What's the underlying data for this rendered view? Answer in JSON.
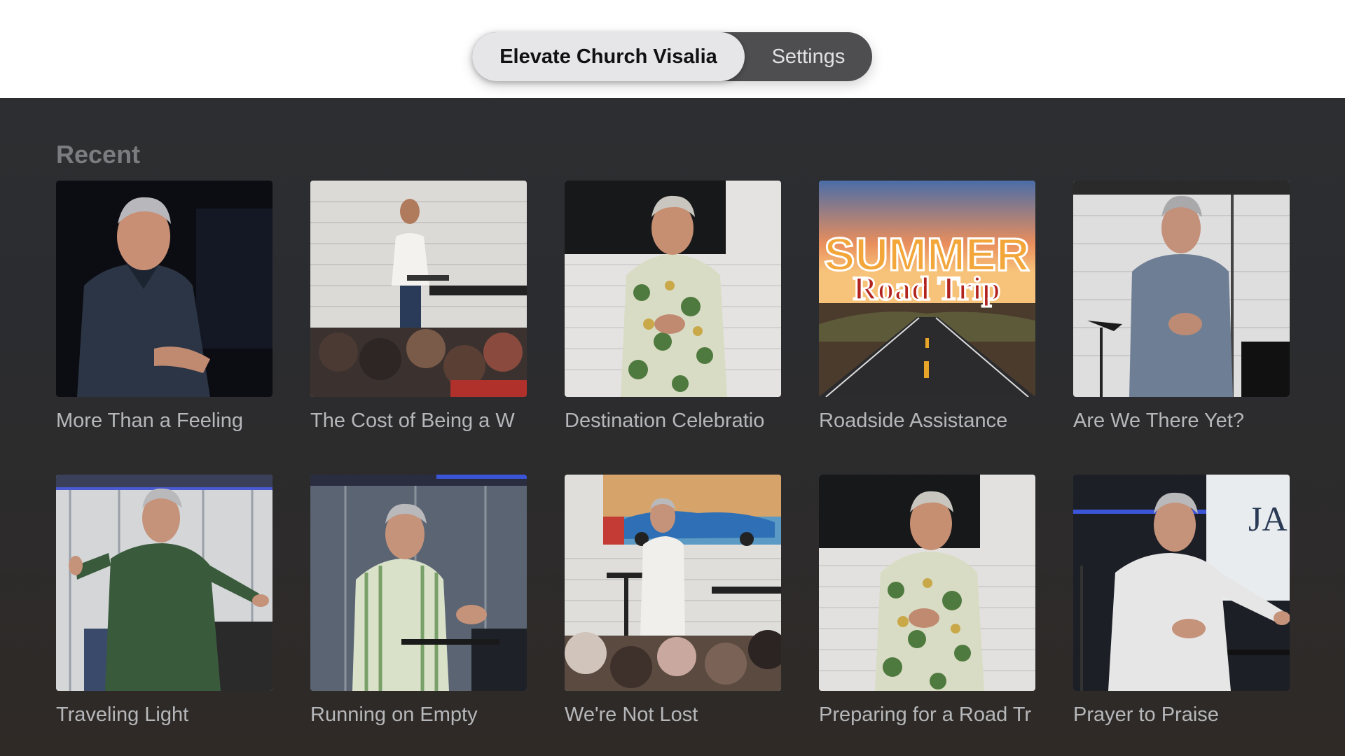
{
  "header": {
    "tabs": [
      {
        "label": "Elevate Church Visalia",
        "active": true
      },
      {
        "label": "Settings",
        "active": false
      }
    ]
  },
  "main": {
    "section_title": "Recent",
    "items": [
      {
        "title": "More Than a Feeling",
        "thumbnail": "speaker-dark-stage"
      },
      {
        "title": "The Cost of Being a W",
        "thumbnail": "speaker-with-audience"
      },
      {
        "title": "Destination Celebratio",
        "thumbnail": "speaker-floral-shirt"
      },
      {
        "title": "Roadside Assistance",
        "thumbnail": "summer-road-trip-graphic"
      },
      {
        "title": "Are We There Yet?",
        "thumbnail": "speaker-blue-shirt"
      },
      {
        "title": "Traveling Light",
        "thumbnail": "speaker-green-shirt"
      },
      {
        "title": "Running on Empty",
        "thumbnail": "speaker-striped-shirt"
      },
      {
        "title": "We're Not Lost",
        "thumbnail": "speaker-car-mural-audience"
      },
      {
        "title": "Preparing for a Road Tr",
        "thumbnail": "speaker-floral-shirt"
      },
      {
        "title": "Prayer to Praise",
        "thumbnail": "speaker-white-shirt-screen"
      }
    ],
    "graphic_text": {
      "line1": "SUMMER",
      "line2": "Road Trip"
    }
  },
  "colors": {
    "tabbar_bg": "#4e4e50",
    "tab_active_bg": "#e6e6e9",
    "content_bg": "#2c2e31",
    "title_text": "#b6b7ba",
    "section_text": "#7b7c80"
  }
}
